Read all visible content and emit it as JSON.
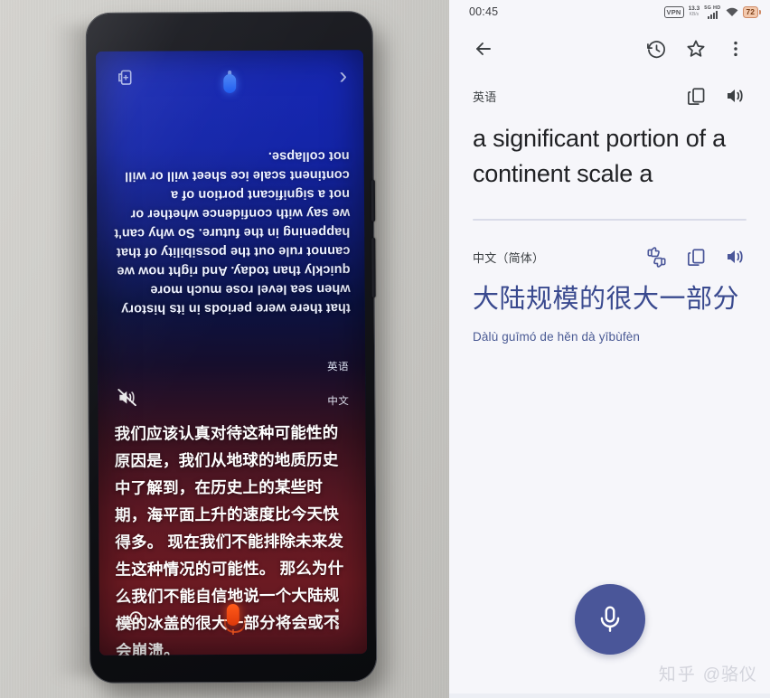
{
  "left_photo": {
    "description": "photo of a phone on a desk running Google Assistant interpreter mode",
    "phone": {
      "top_bar": {
        "fullscreen_icon": "fullscreen-icon",
        "assistant_icon": "assistant-mic-indicator",
        "chevron_icon": "chevron-right-icon"
      },
      "english_text": "that there were periods in its history when sea level rose much more quickly than today. And right now we cannot rule out the possibility of that happening in the future. So why can't we say with confidence whether or not a significant portion of a continent scale ice sheet will or will not collapse.",
      "source_lang_label": "英语",
      "target_lang_label": "中文",
      "mute_icon": "volume-off-icon",
      "chinese_text": "我们应该认真对待这种可能性的原因是，我们从地球的地质历史中了解到，在历史上的某些时期，海平面上升的速度比今天快得多。 现在我们不能排除未来发生这种情况的可能性。 那么为什么我们不能自信地说一个大陆规模的冰盖的很大一部分将会或不会崩溃。",
      "bottom_bar": {
        "history_icon": "history-keyboard-icon",
        "mic_icon": "mic-icon",
        "more_icon": "more-vertical-icon"
      }
    }
  },
  "app": {
    "statusbar": {
      "time": "00:45",
      "vpn_label": "VPN",
      "net_speed_value": "13.3",
      "net_speed_unit": "KB/s",
      "network_label": "5G HD",
      "signal_icon": "signal-bars-icon",
      "wifi_icon": "wifi-icon",
      "battery_level": "72"
    },
    "toolbar": {
      "back_icon": "back-arrow-icon",
      "history_icon": "history-icon",
      "star_icon": "star-outline-icon",
      "more_icon": "more-vertical-icon"
    },
    "source": {
      "lang_label": "英语",
      "copy_icon": "copy-icon",
      "speaker_icon": "volume-up-icon",
      "text": "a significant portion of a continent scale a"
    },
    "target": {
      "lang_label": "中文（简体）",
      "rate_icon": "thumbs-up-down-icon",
      "copy_icon": "copy-icon",
      "speaker_icon": "volume-up-icon",
      "text": "大陆规模的很大一部分",
      "pinyin": "Dàlù guīmó de hěn dà yībùfèn"
    },
    "fab": {
      "mic_icon": "mic-icon"
    },
    "watermark": {
      "logo": "知乎",
      "handle": "@骆仪"
    },
    "colors": {
      "app_background": "#f6f6fa",
      "source_text": "#202124",
      "target_text": "#3a4a8f",
      "fab": "#4a5699",
      "divider": "#d9dbe8",
      "battery_chip": "#f3c9ad"
    }
  }
}
